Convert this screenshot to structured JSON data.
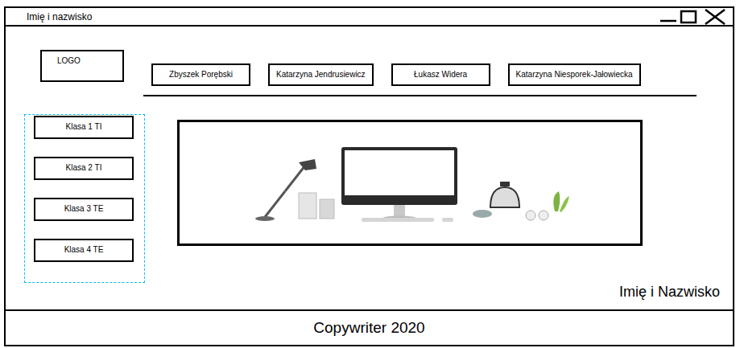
{
  "window": {
    "title": "Imię i nazwisko"
  },
  "logo": {
    "label": "LOGO"
  },
  "nav": {
    "items": [
      {
        "label": "Zbyszek Porębski"
      },
      {
        "label": "Katarzyna Jendrusiewicz"
      },
      {
        "label": "Łukasz Widera"
      },
      {
        "label": "Katarzyna Niesporek-Jałowiecka"
      }
    ]
  },
  "sidebar": {
    "items": [
      {
        "label": "Klasa 1 TI"
      },
      {
        "label": "Klasa 2 TI"
      },
      {
        "label": "Klasa 3 TE"
      },
      {
        "label": "Klasa 4 TE"
      }
    ]
  },
  "author": "Imię i Nazwisko",
  "footer": {
    "text": "Copywriter 2020"
  }
}
